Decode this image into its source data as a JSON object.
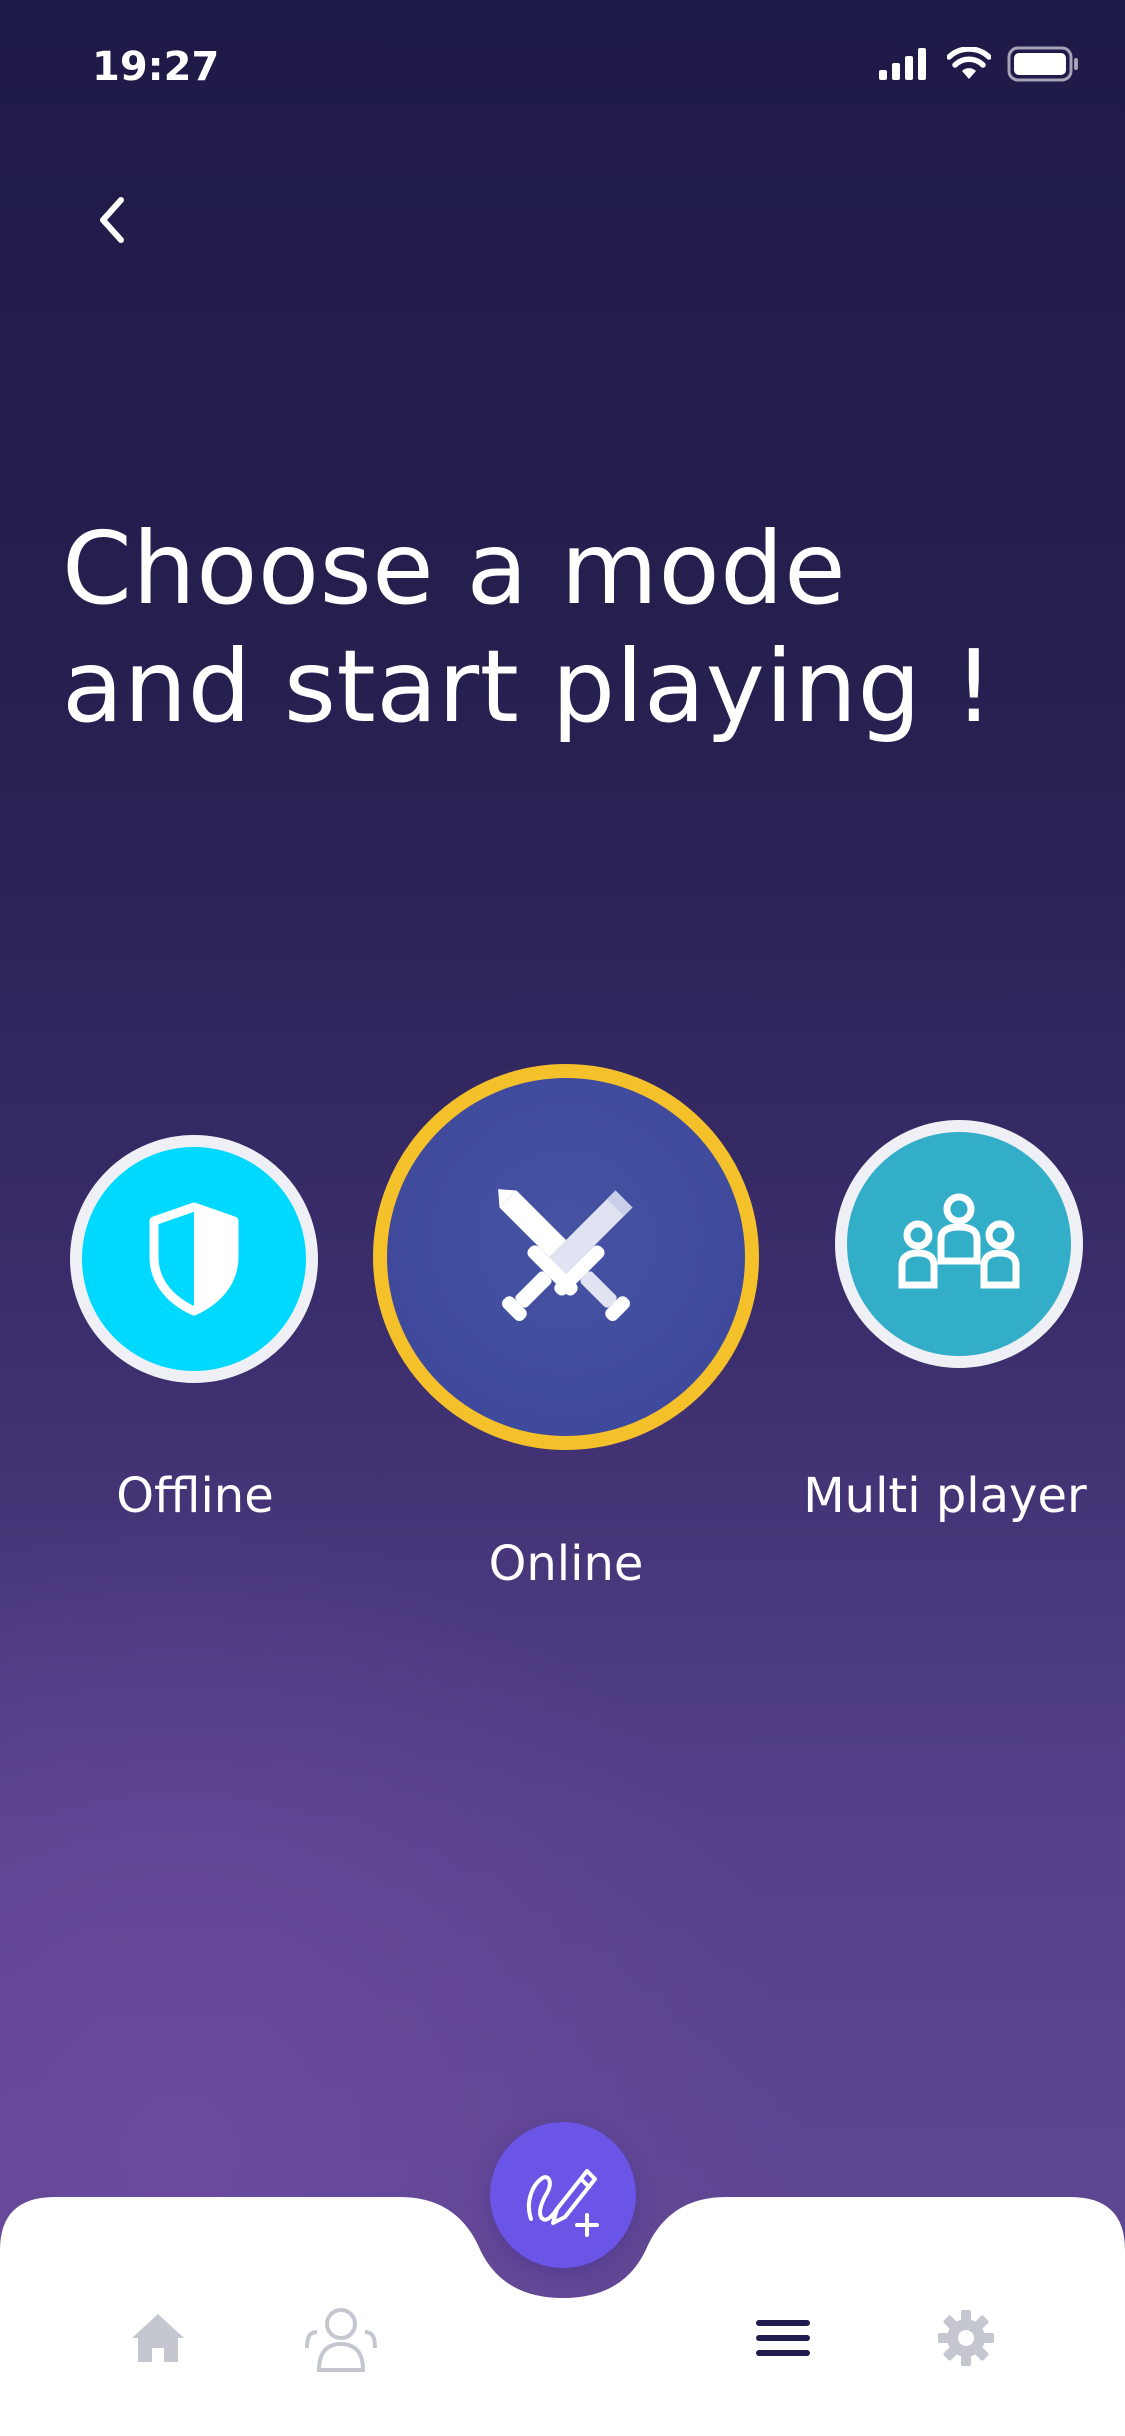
{
  "status_bar": {
    "time": "19:27",
    "icons": [
      "signal-icon",
      "wifi-icon",
      "battery-icon"
    ]
  },
  "header": {
    "back_icon": "chevron-left-icon",
    "title_line1": "Choose a mode",
    "title_line2": "and start playing !"
  },
  "modes": [
    {
      "id": "offline",
      "label": "Offline",
      "icon": "shield-icon",
      "color": "#00d9ff",
      "selected": false
    },
    {
      "id": "online",
      "label": "Online",
      "icon": "crossed-swords-icon",
      "color": "#3f4a9c",
      "selected": true
    },
    {
      "id": "multi",
      "label": "Multi player",
      "icon": "group-icon",
      "color": "#33aec8",
      "selected": false
    }
  ],
  "tab_bar": {
    "items": [
      {
        "icon": "home-icon"
      },
      {
        "icon": "friends-icon"
      },
      {
        "icon": "menu-icon"
      },
      {
        "icon": "gear-icon"
      }
    ],
    "fab_icon": "draw-add-icon"
  },
  "colors": {
    "background_top": "#1e1a47",
    "background_bottom": "#5b4590",
    "selected_ring": "#f5c12a",
    "fab": "#6a55e6"
  }
}
